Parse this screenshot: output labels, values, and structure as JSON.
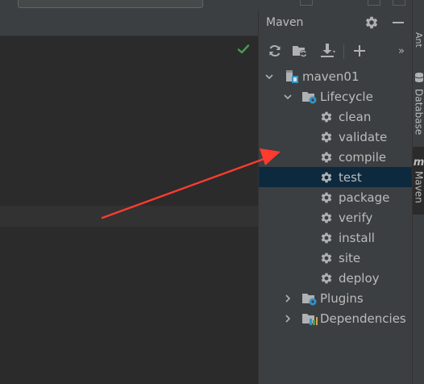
{
  "colors": {
    "editor_bg": "#2b2b2b",
    "panel_bg": "#3c3f41",
    "selection_bg": "#0d293e",
    "text": "#bbbbbb",
    "icon_gray": "#afb1b3",
    "icon_blue": "#3592c4",
    "check_green": "#499c54",
    "annotation_red": "#ff3b30"
  },
  "panel": {
    "title": "Maven",
    "settings_icon": "gear-icon",
    "minimize_icon": "minus-icon"
  },
  "toolbar": {
    "items": [
      {
        "name": "reload-icon"
      },
      {
        "name": "generate-sources-icon"
      },
      {
        "name": "download-icon"
      },
      {
        "name": "add-icon"
      },
      {
        "name": "more-icon",
        "label": "»"
      }
    ]
  },
  "tree": {
    "project": {
      "label": "maven01",
      "icon": "maven-project-icon",
      "expanded": true
    },
    "lifecycle": {
      "label": "Lifecycle",
      "icon": "lifecycle-folder-icon",
      "expanded": true,
      "phases": [
        {
          "label": "clean",
          "selected": false
        },
        {
          "label": "validate",
          "selected": false
        },
        {
          "label": "compile",
          "selected": false
        },
        {
          "label": "test",
          "selected": true
        },
        {
          "label": "package",
          "selected": false
        },
        {
          "label": "verify",
          "selected": false
        },
        {
          "label": "install",
          "selected": false
        },
        {
          "label": "site",
          "selected": false
        },
        {
          "label": "deploy",
          "selected": false
        }
      ]
    },
    "plugins": {
      "label": "Plugins",
      "icon": "plugins-folder-icon",
      "expanded": false
    },
    "dependencies": {
      "label": "Dependencies",
      "icon": "dependencies-folder-icon",
      "expanded": false
    }
  },
  "right_stripe": {
    "tabs": [
      {
        "label": "Ant",
        "icon": "ant-icon",
        "active": false
      },
      {
        "label": "Database",
        "icon": "database-icon",
        "active": false
      },
      {
        "label": "Maven",
        "icon": "maven-icon",
        "active": true
      }
    ]
  },
  "editor": {
    "status_icon": "check-icon"
  }
}
